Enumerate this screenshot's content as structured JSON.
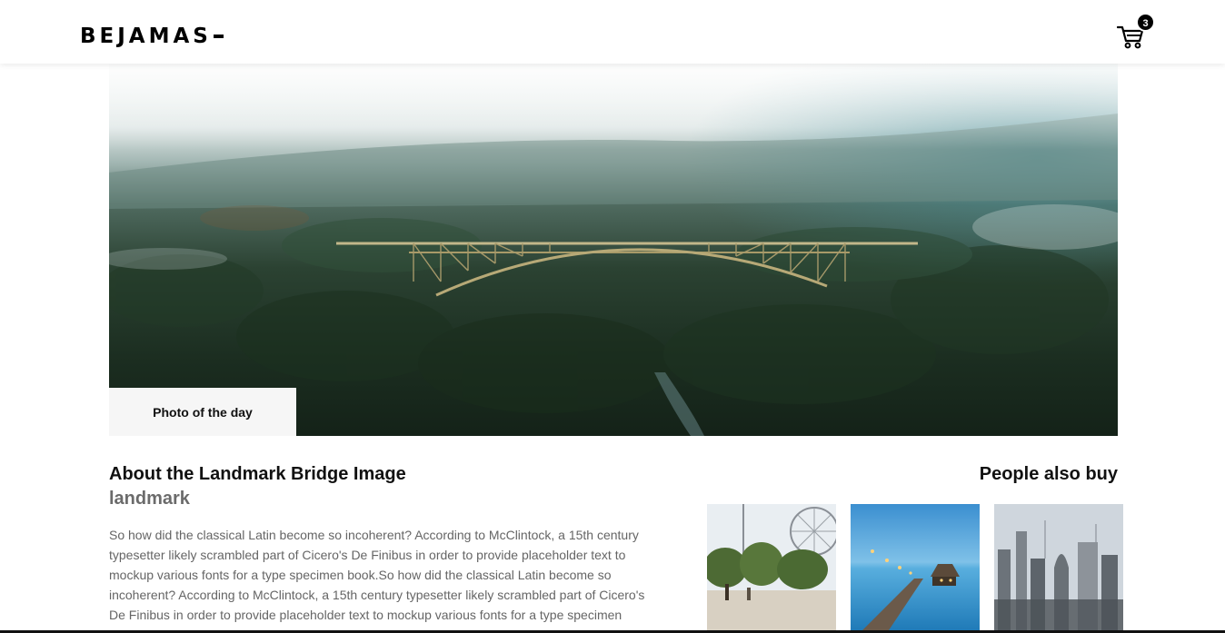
{
  "header": {
    "logo_text": "BEJAMAS",
    "cart_count": "3"
  },
  "hero": {
    "label": "Photo of the day"
  },
  "product": {
    "title": "About the Landmark Bridge Image",
    "category": "landmark",
    "description": "So how did the classical Latin become so incoherent? According to McClintock, a 15th century typesetter likely scrambled part of Cicero's De Finibus in order to provide placeholder text to mockup various fonts for a type specimen book.So how did the classical Latin become so incoherent? According to McClintock, a 15th century typesetter likely scrambled part of Cicero's De Finibus in order to provide placeholder text to mockup various fonts for a type specimen book.So how did the classical Latin become so incoherent? According to McClintock"
  },
  "recommendations": {
    "title": "People also buy",
    "items": [
      {
        "name": "ferris-wheel-park"
      },
      {
        "name": "pier-at-dusk"
      },
      {
        "name": "city-skyline"
      }
    ]
  },
  "colors": {
    "badge": "#000000",
    "label_bg": "#f6f6f6",
    "muted_text": "#656565",
    "category_text": "#6b6b6b"
  }
}
